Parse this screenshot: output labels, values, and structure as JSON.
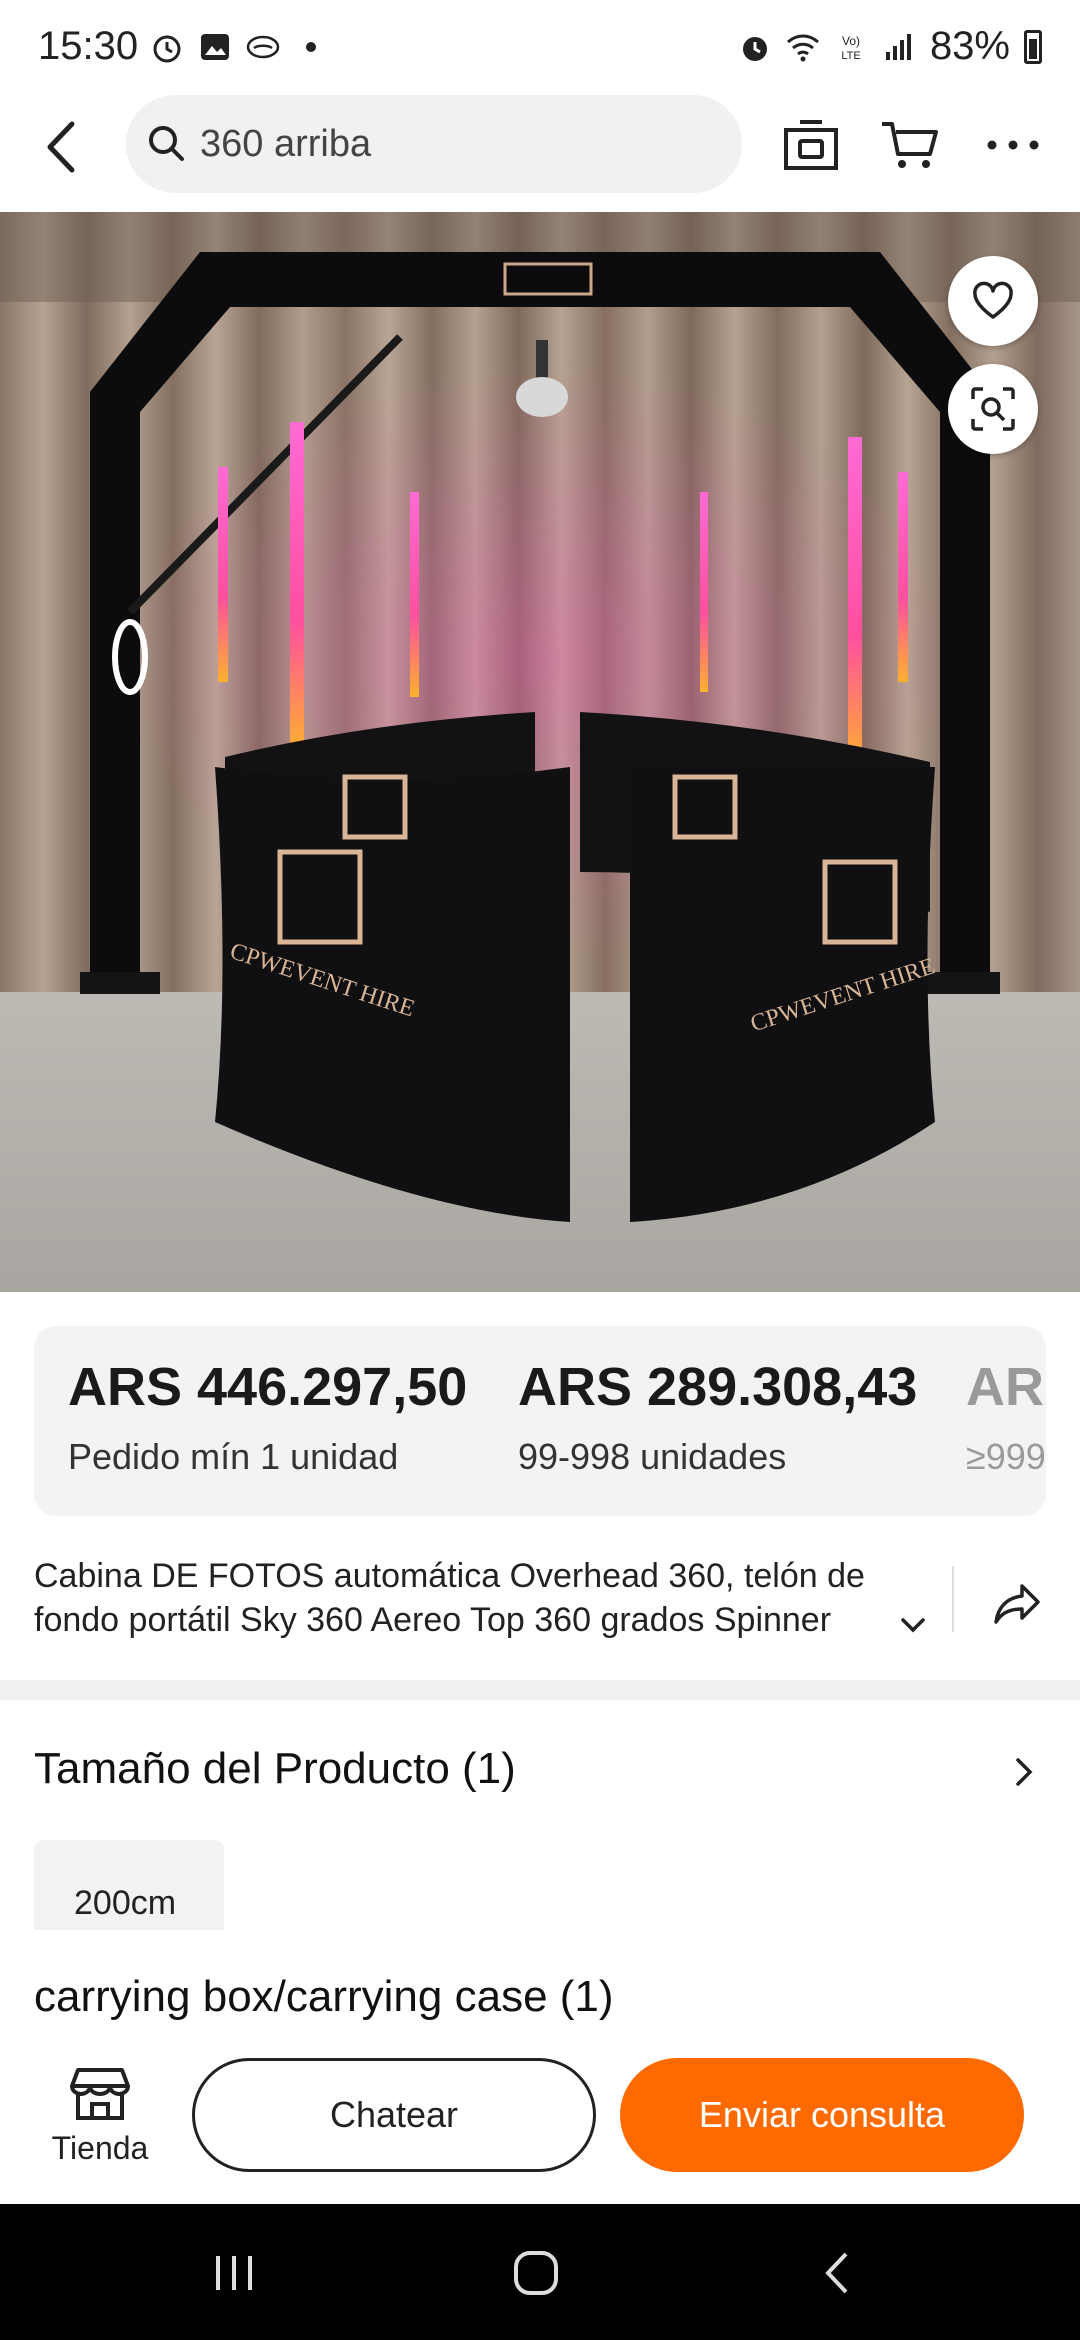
{
  "status_bar": {
    "time": "15:30",
    "battery": "83%",
    "left_icons": [
      "alarm-icon",
      "gallery-icon",
      "app-icon",
      "dot-icon"
    ],
    "right_icons": [
      "alarm-icon",
      "wifi-icon",
      "volte-icon",
      "signal-icon",
      "battery-icon"
    ]
  },
  "header": {
    "search_query": "360 arriba",
    "icons": [
      "back-icon",
      "search-icon",
      "camera-icon",
      "cart-icon",
      "more-icon"
    ]
  },
  "hero": {
    "image_icons": [
      "heart-icon",
      "lens-search-icon"
    ],
    "logo_text": "CPWEVENT HIRE"
  },
  "pricing": {
    "tiers": [
      {
        "price": "ARS 446.297,50",
        "quantity": "Pedido mín 1 unidad"
      },
      {
        "price": "ARS 289.308,43",
        "quantity": "99-998 unidades"
      },
      {
        "price": "ARS",
        "quantity": "≥999"
      }
    ]
  },
  "product": {
    "title": "Cabina DE FOTOS automática Overhead 360, telón de fondo portátil Sky 360 Aereo Top 360 grados Spinner"
  },
  "variants": {
    "size_title": "Tamaño del Producto (1)",
    "size_option": "200cm",
    "box_title": "carrying box/carrying case (1)"
  },
  "actions": {
    "store_label": "Tienda",
    "chat_label": "Chatear",
    "inquiry_label": "Enviar consulta",
    "accent_color": "#ff6a00"
  }
}
